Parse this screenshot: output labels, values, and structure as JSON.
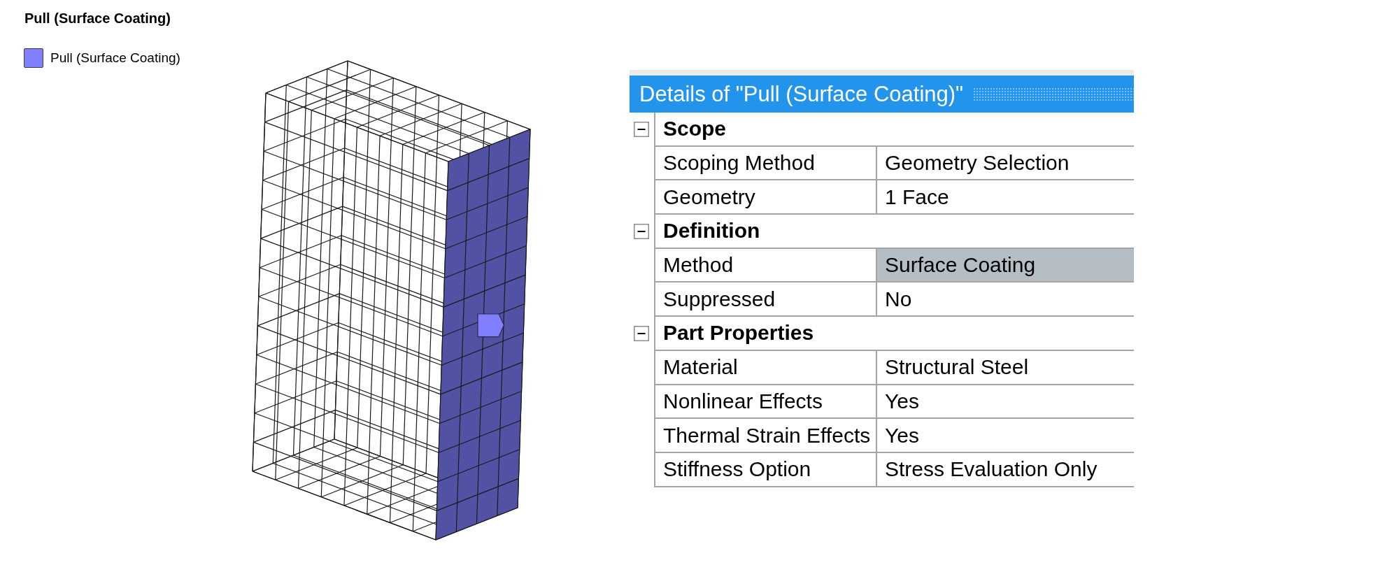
{
  "viewport": {
    "title": "Pull (Surface Coating)",
    "legend": [
      {
        "label": "Pull (Surface Coating)",
        "color": "#8080ff"
      }
    ]
  },
  "details": {
    "title": "Details of \"Pull (Surface Coating)\"",
    "groups": [
      {
        "name": "Scope",
        "expanded": true,
        "properties": [
          {
            "name": "Scoping Method",
            "value": "Geometry Selection",
            "selected": false
          },
          {
            "name": "Geometry",
            "value": "1 Face",
            "selected": false
          }
        ]
      },
      {
        "name": "Definition",
        "expanded": true,
        "properties": [
          {
            "name": "Method",
            "value": "Surface Coating",
            "selected": true
          },
          {
            "name": "Suppressed",
            "value": "No",
            "selected": false
          }
        ]
      },
      {
        "name": "Part Properties",
        "expanded": true,
        "properties": [
          {
            "name": "Material",
            "value": "Structural Steel",
            "selected": false
          },
          {
            "name": "Nonlinear Effects",
            "value": "Yes",
            "selected": false
          },
          {
            "name": "Thermal Strain Effects",
            "value": "Yes",
            "selected": false
          },
          {
            "name": "Stiffness Option",
            "value": "Stress Evaluation Only",
            "selected": false
          }
        ]
      }
    ]
  }
}
